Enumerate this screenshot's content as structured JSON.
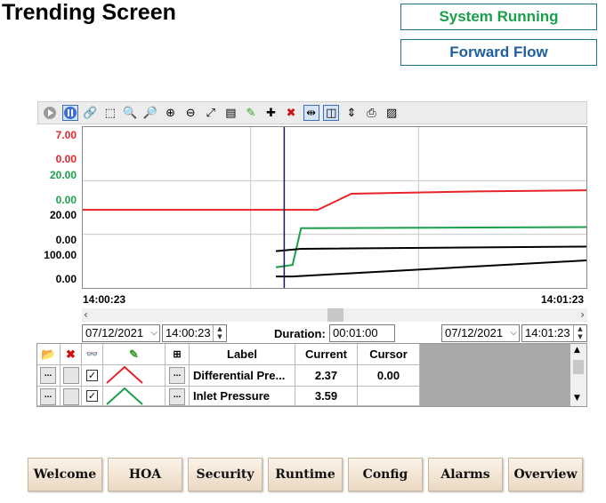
{
  "header": {
    "title": "Trending Screen"
  },
  "status": {
    "system": "System Running",
    "flow": "Forward Flow",
    "colors": {
      "running": "#1aa04a",
      "flow": "#1f5fa0"
    }
  },
  "toolbar": {
    "icons": [
      "play-icon",
      "pause-icon",
      "link-icon",
      "zoom-box-icon",
      "zoom-x-icon",
      "zoom-y-icon",
      "zoom-in-icon",
      "zoom-out-icon",
      "reset-zoom-icon",
      "table-icon",
      "pen-edit-icon",
      "add-pen-icon",
      "delete-pen-icon",
      "cursor-icon",
      "split-view-icon",
      "fit-icon",
      "print-icon",
      "export-icon"
    ]
  },
  "chart_data": {
    "type": "line",
    "x_range": [
      "14:00:23",
      "14:01:23"
    ],
    "series": [
      {
        "axis_max": "7.00",
        "axis_min": "0.00",
        "color": "#e8232a",
        "points": [
          [
            "14:00:23",
            3.4
          ],
          [
            "14:00:51",
            3.4
          ],
          [
            "14:00:55",
            4.1
          ],
          [
            "14:01:10",
            4.2
          ],
          [
            "14:01:23",
            4.25
          ]
        ]
      },
      {
        "axis_max": "20.00",
        "axis_min": "0.00",
        "color": "#1aa04a",
        "points": [
          [
            "14:00:46",
            0.9
          ],
          [
            "14:00:48",
            1.0
          ],
          [
            "14:00:49",
            2.6
          ],
          [
            "14:01:23",
            2.65
          ]
        ]
      },
      {
        "axis_max": "20.00",
        "axis_min": "0.00",
        "color": "#000000",
        "points": [
          [
            "14:00:46",
            1.6
          ],
          [
            "14:00:49",
            1.7
          ],
          [
            "14:01:23",
            1.8
          ]
        ]
      },
      {
        "axis_max": "100.00",
        "axis_min": "0.00",
        "color": "#000000",
        "points": [
          [
            "14:00:46",
            0.5
          ],
          [
            "14:00:48",
            0.5
          ],
          [
            "14:01:23",
            1.2
          ]
        ]
      }
    ],
    "grid": true,
    "cursor_time": "14:00:47"
  },
  "time": {
    "start": "14:00:23",
    "end": "14:01:23"
  },
  "range": {
    "start_date": "07/12/2021",
    "start_time": "14:00:23",
    "duration_label": "Duration:",
    "duration": "00:01:00",
    "end_date": "07/12/2021",
    "end_time": "14:01:23"
  },
  "table": {
    "headers": {
      "label": "Label",
      "current": "Current",
      "cursor": "Cursor"
    },
    "rows": [
      {
        "label": "Differential Pre...",
        "current": "2.37",
        "cursor": "0.00",
        "color": "#e8232a"
      },
      {
        "label": "Inlet Pressure",
        "current": "3.59",
        "cursor": "",
        "color": "#1aa04a"
      }
    ]
  },
  "nav": [
    "Welcome",
    "HOA",
    "Security",
    "Runtime",
    "Config",
    "Alarms",
    "Overview"
  ]
}
